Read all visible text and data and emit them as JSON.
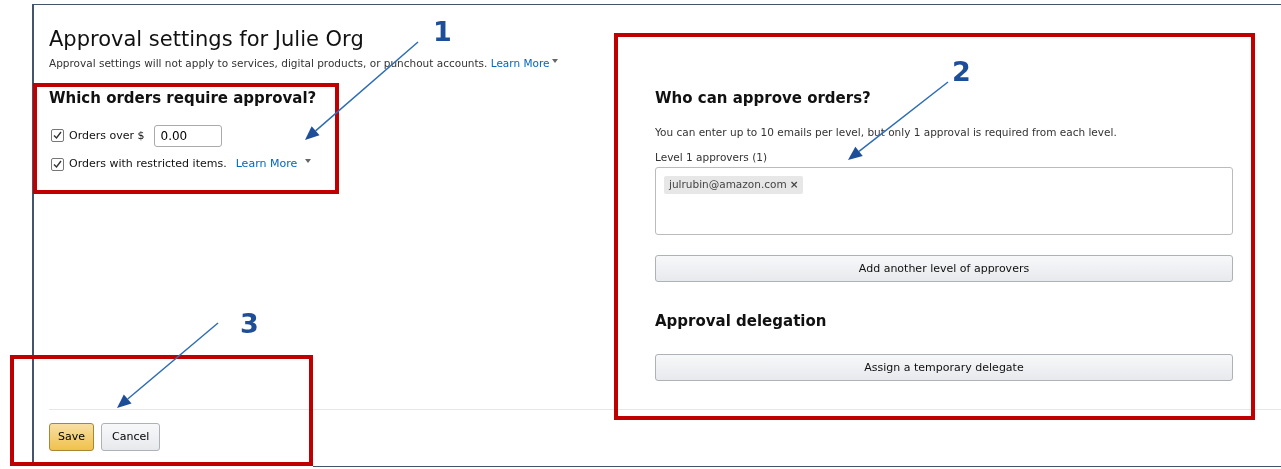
{
  "page": {
    "title": "Approval settings for Julie Org",
    "notice": "Approval settings will not apply to services, digital products, or punchout accounts.",
    "notice_link": "Learn More"
  },
  "orders_section": {
    "heading": "Which orders require approval?",
    "options": [
      {
        "label": "Orders over $",
        "checked": true,
        "value": "0.00"
      },
      {
        "label": "Orders with restricted items.",
        "checked": true,
        "link": "Learn More"
      }
    ]
  },
  "approvers_section": {
    "heading": "Who can approve orders?",
    "description": "You can enter up to 10 emails per level, but only 1 approval is required from each level.",
    "levels": [
      {
        "label": "Level 1 approvers (1)",
        "emails": [
          {
            "text": "julrubin@amazon.com",
            "remove": "×"
          }
        ]
      }
    ],
    "add_button": "Add another level of approvers"
  },
  "delegation_section": {
    "heading": "Approval delegation",
    "button": "Assign a temporary delegate"
  },
  "footer": {
    "buttons": [
      {
        "label": "Save",
        "kind": "primary"
      },
      {
        "label": "Cancel",
        "kind": "secondary"
      }
    ]
  },
  "annotations": [
    {
      "label": "1"
    },
    {
      "label": "2"
    },
    {
      "label": "3"
    }
  ]
}
